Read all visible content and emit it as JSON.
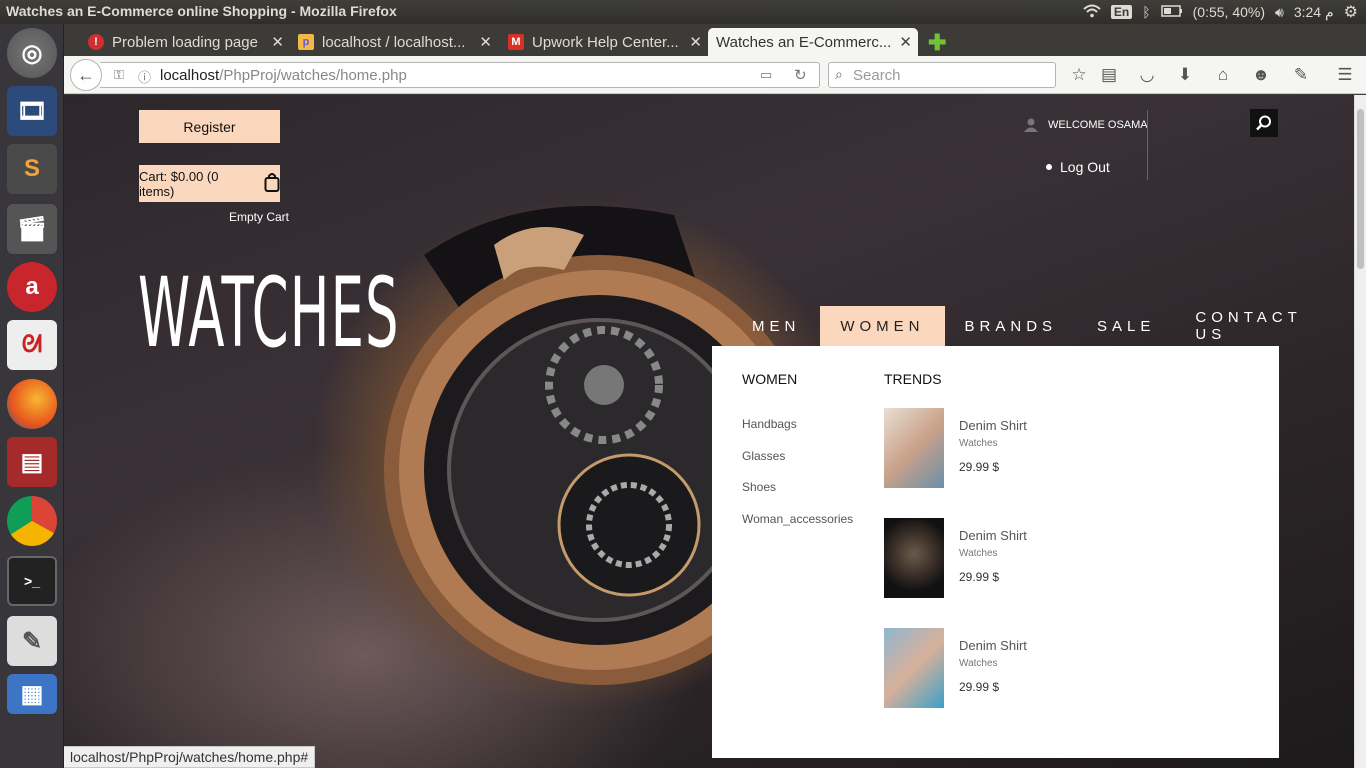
{
  "window": {
    "title": "Watches an E-Commerce online Shopping - Mozilla Firefox"
  },
  "tray": {
    "lang": "En",
    "battery": "(0:55, 40%)",
    "clock": "3:24 م"
  },
  "tabs": [
    {
      "label": "Problem loading page",
      "icon": "error-icon"
    },
    {
      "label": "localhost / localhost...",
      "icon": "phpmyadmin-icon"
    },
    {
      "label": "Upwork Help Center...",
      "icon": "gmail-icon"
    },
    {
      "label": "Watches an E-Commerc...",
      "icon": "page-icon",
      "active": true
    }
  ],
  "navbar": {
    "url_host": "localhost",
    "url_path": "/PhpProj/watches/home.php",
    "search_placeholder": "Search"
  },
  "header": {
    "register": "Register",
    "cart": "Cart: $0.00 (0 items)",
    "empty_cart": "Empty Cart",
    "logo": "WATCHES",
    "welcome": "WELCOME OSAMA",
    "logout": "Log Out"
  },
  "menu": [
    {
      "label": "MEN"
    },
    {
      "label": "WOMEN",
      "active": true
    },
    {
      "label": "BRANDS"
    },
    {
      "label": "SALE"
    },
    {
      "label": "CONTACT US"
    }
  ],
  "dropdown": {
    "women_heading": "WOMEN",
    "trends_heading": "TRENDS",
    "categories": [
      "Handbags",
      "Glasses",
      "Shoes",
      "Woman_accessories"
    ],
    "products": [
      {
        "name": "Denim Shirt",
        "type": "Watches",
        "price": "29.99 $"
      },
      {
        "name": "Denim Shirt",
        "type": "Watches",
        "price": "29.99 $"
      },
      {
        "name": "Denim Shirt",
        "type": "Watches",
        "price": "29.99 $"
      }
    ]
  },
  "status": "localhost/PhpProj/watches/home.php#",
  "colors": {
    "accent": "#fbd7bd",
    "panel": "#3c3b37"
  }
}
